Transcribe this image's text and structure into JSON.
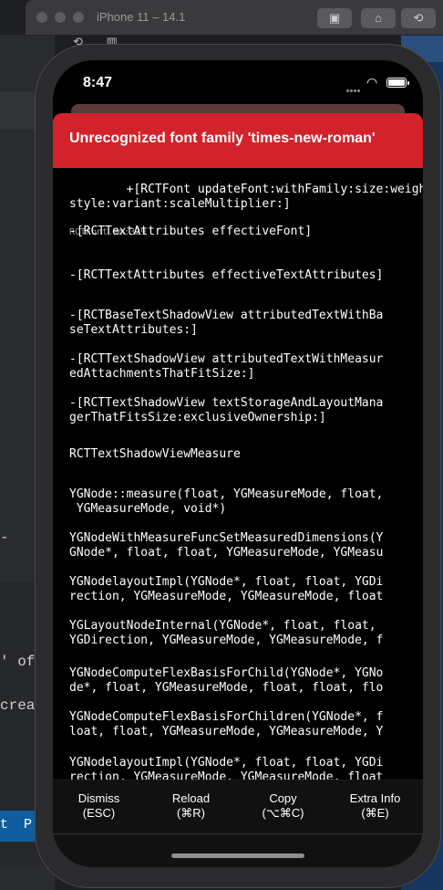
{
  "simulator": {
    "title": "iPhone 11 – 14.1",
    "toolbar": [
      {
        "name": "screenshot",
        "icon": "camera-icon",
        "glyph": "▣"
      },
      {
        "name": "home",
        "icon": "home-icon",
        "glyph": "⌂"
      },
      {
        "name": "rotate",
        "icon": "rotate-icon",
        "glyph": "⟲"
      }
    ]
  },
  "desktop": {
    "left_fragments": [
      "-",
      "' of",
      "creat",
      "t",
      "P"
    ]
  },
  "phone": {
    "status_time": "8:47",
    "error_title": "Unrecognized font family 'times-new-roman'",
    "frames": [
      {
        "text": "+[RCTFont updateFont:withFamily:size:weight:\nstyle:variant:scaleMultiplier:]",
        "file": "RCTFont.mm:329"
      },
      {
        "text": "-[RCTTextAttributes effectiveFont]",
        "file": ""
      },
      {
        "text": "-[RCTTextAttributes effectiveTextAttributes]",
        "file": ""
      },
      {
        "text": "-[RCTBaseTextShadowView attributedTextWithBa\nseTextAttributes:]",
        "file": ""
      },
      {
        "text": "-[RCTTextShadowView attributedTextWithMeasur\nedAttachmentsThatFitSize:]",
        "file": ""
      },
      {
        "text": "-[RCTTextShadowView textStorageAndLayoutMana\ngerThatFitsSize:exclusiveOwnership:]",
        "file": ""
      },
      {
        "text": "RCTTextShadowViewMeasure",
        "file": ""
      },
      {
        "text": "YGNode::measure(float, YGMeasureMode, float,\n YGMeasureMode, void*)",
        "file": ""
      },
      {
        "text": "YGNodeWithMeasureFuncSetMeasuredDimensions(Y\nGNode*, float, float, YGMeasureMode, YGMeasu",
        "file": ""
      },
      {
        "text": "YGNodelayoutImpl(YGNode*, float, float, YGDi\nrection, YGMeasureMode, YGMeasureMode, float",
        "file": ""
      },
      {
        "text": "YGLayoutNodeInternal(YGNode*, float, float,\nYGDirection, YGMeasureMode, YGMeasureMode, f",
        "file": ""
      },
      {
        "text": "YGNodeComputeFlexBasisForChild(YGNode*, YGNo\nde*, float, YGMeasureMode, float, float, flo",
        "file": ""
      },
      {
        "text": "YGNodeComputeFlexBasisForChildren(YGNode*, f\nloat, float, YGMeasureMode, YGMeasureMode, Y",
        "file": ""
      },
      {
        "text": "YGNodelayoutImpl(YGNode*, float, float, YGDi\nrection, YGMeasureMode, YGMeasureMode, float",
        "file": ""
      }
    ],
    "buttons": [
      {
        "label": "Dismiss",
        "shortcut": "(ESC)"
      },
      {
        "label": "Reload",
        "shortcut": "(⌘R)"
      },
      {
        "label": "Copy",
        "shortcut": "(⌥⌘C)"
      },
      {
        "label": "Extra Info",
        "shortcut": "(⌘E)"
      }
    ]
  },
  "colors": {
    "error_red": "#d3222a",
    "background": "#000000",
    "desktop_blue": "#17365e"
  }
}
